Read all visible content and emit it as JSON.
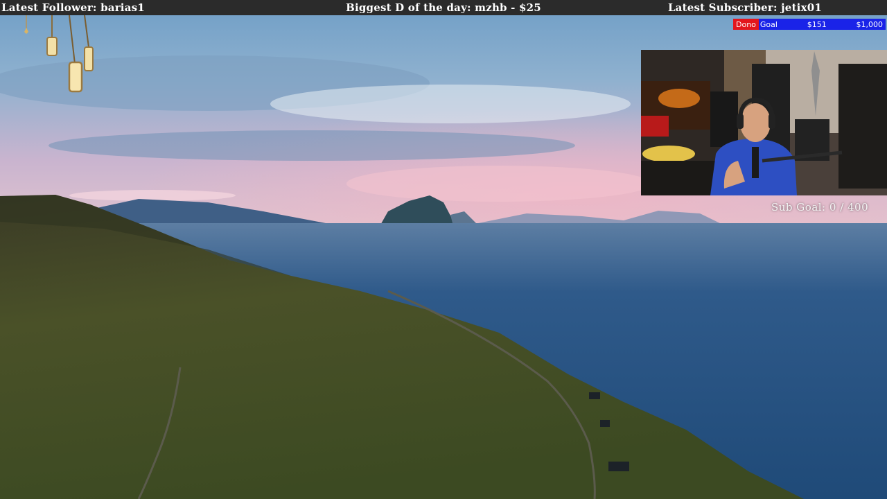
{
  "overlay": {
    "latest_follower": "Latest Follower: barias1",
    "biggest_donation": "Biggest D of the day: mzhb - $25",
    "latest_subscriber": "Latest Subscriber: jetix01"
  },
  "dono_goal": {
    "label_red": "Dono",
    "label_blue": "Goal",
    "current": "$151",
    "target": "$1,000",
    "progress": 0.151
  },
  "sub_goal": {
    "text": "Sub Goal: 0 / 400"
  },
  "colors": {
    "topbar": "#2b2b2b",
    "dono_red": "#e3161d",
    "dono_blue": "#1a23e8"
  }
}
